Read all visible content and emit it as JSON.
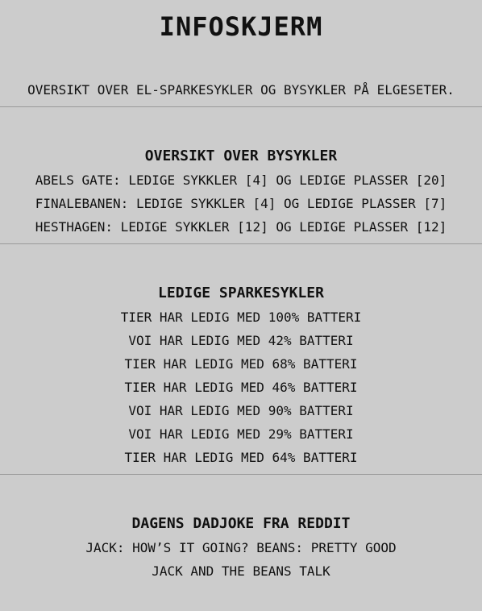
{
  "header": {
    "title": "INFOSKJERM",
    "subtitle": "OVERSIKT OVER EL-SPARKESYKLER OG BYSYKLER PÅ ELGESETER."
  },
  "bysykler": {
    "heading": "OVERSIKT OVER BYSYKLER",
    "lines": [
      "ABELS GATE: LEDIGE SYKKLER [4] OG LEDIGE PLASSER [20]",
      "FINALEBANEN: LEDIGE SYKKLER [4] OG LEDIGE PLASSER [7]",
      "HESTHAGEN: LEDIGE SYKKLER [12] OG LEDIGE PLASSER [12]"
    ]
  },
  "sparkesykler": {
    "heading": "LEDIGE SPARKESYKLER",
    "lines": [
      "TIER HAR LEDIG MED 100% BATTERI",
      "VOI HAR LEDIG MED 42% BATTERI",
      "TIER HAR LEDIG MED 68% BATTERI",
      "TIER HAR LEDIG MED 46% BATTERI",
      "VOI HAR LEDIG MED 90% BATTERI",
      "VOI HAR LEDIG MED 29% BATTERI",
      "TIER HAR LEDIG MED 64% BATTERI"
    ]
  },
  "dadjoke": {
    "heading": "DAGENS DADJOKE FRA REDDIT",
    "lines": [
      "JACK: HOW’S IT GOING? BEANS: PRETTY GOOD",
      "JACK AND THE BEANS TALK"
    ]
  }
}
